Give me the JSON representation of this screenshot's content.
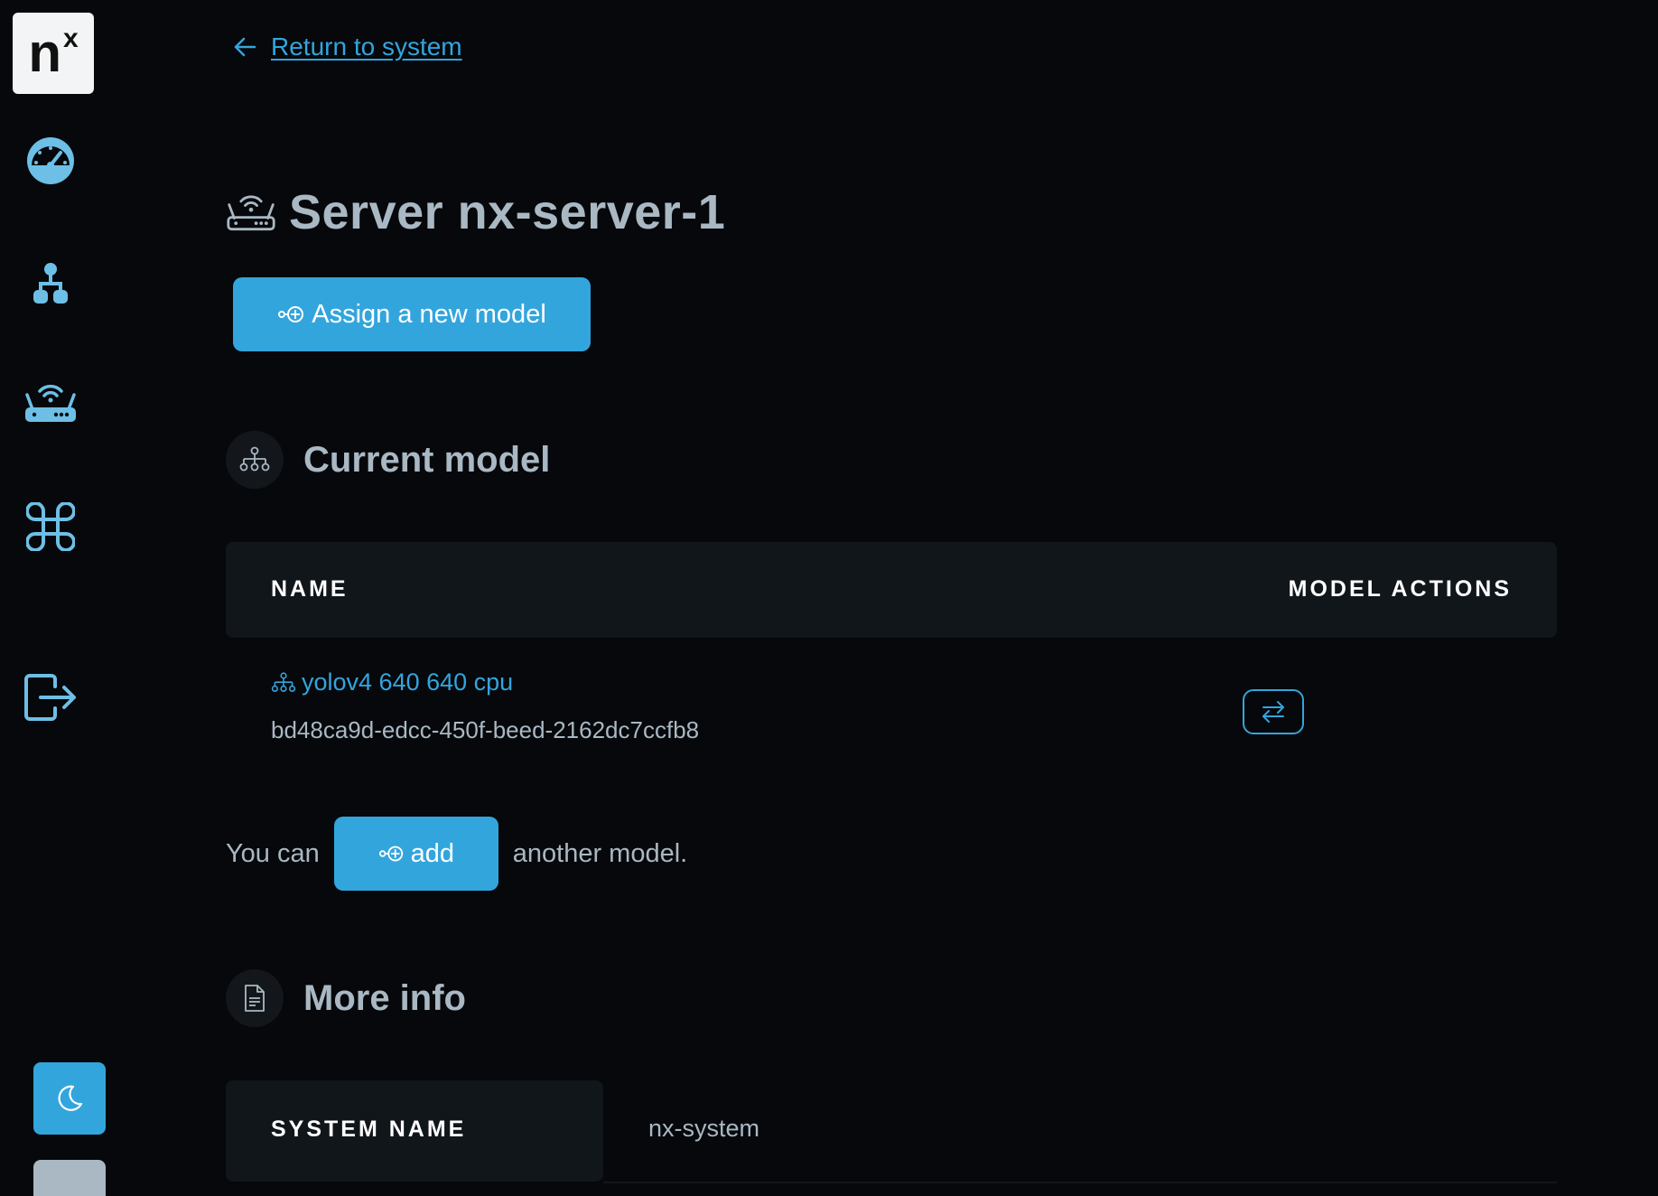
{
  "back_link": "Return to system",
  "title": "Server nx-server-1",
  "assign_button": "Assign a new model",
  "sections": {
    "current_model": "Current model",
    "more_info": "More info"
  },
  "table": {
    "headers": [
      "NAME",
      "MODEL ACTIONS"
    ],
    "rows": [
      {
        "name": "yolov4 640 640 cpu",
        "id": "bd48ca9d-edcc-450f-beed-2162dc7ccfb8"
      }
    ]
  },
  "add_line": {
    "prefix": "You can",
    "button": "add",
    "suffix": "another model."
  },
  "info": {
    "system_name_label": "SYSTEM NAME",
    "system_name_value": "nx-system"
  },
  "logo": {
    "main": "n",
    "sup": "x"
  },
  "colors": {
    "accent": "#33a5dd",
    "background": "#06080b",
    "panel": "#11161b",
    "text": "#a9b8c3"
  },
  "icons": [
    "dashboard-icon",
    "models-icon",
    "server-icon",
    "command-icon",
    "logout-icon",
    "moon-icon",
    "router-icon",
    "hierarchy-icon",
    "document-icon",
    "swap-icon",
    "arrow-left-icon"
  ]
}
